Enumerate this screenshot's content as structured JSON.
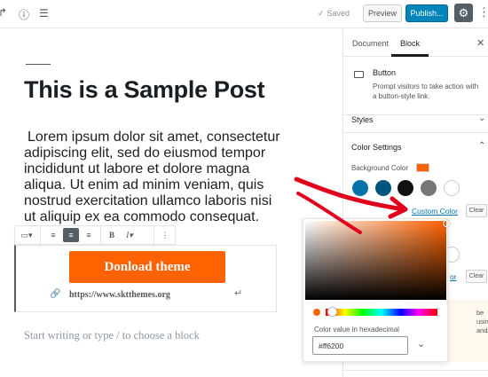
{
  "topbar": {
    "redo_icon": "redo-icon",
    "info_icon": "info-icon",
    "outline_icon": "list-icon",
    "saved_label": "Saved",
    "preview_label": "Preview",
    "publish_label": "Publish...",
    "gear_icon": "gear-icon",
    "more_icon": "more-vertical-icon"
  },
  "editor": {
    "title": "This is a Sample Post",
    "paragraph": "Lorem ipsum dolor sit amet, consectetur adipiscing elit, sed do eiusmod tempor incididunt ut labore et dolore magna aliqua. Ut enim ad minim veniam, quis nostrud exercitation ullamco laboris nisi ut aliquip ex ea commodo consequat.",
    "button_text": "Donload theme",
    "button_url": "https://www.sktthemes.org",
    "placeholder": "Start writing or type / to choose a block",
    "toolbar": {
      "bold_label": "B",
      "italic_label": "I"
    }
  },
  "sidebar": {
    "tabs": [
      {
        "label": "Document",
        "active": false
      },
      {
        "label": "Block",
        "active": true
      }
    ],
    "block": {
      "name": "Button",
      "description": "Prompt visitors to take action with a button-style link."
    },
    "styles_label": "Styles",
    "color_settings_label": "Color Settings",
    "background_color_label": "Background Color",
    "background_color": "#ff6200",
    "swatches": [
      "#0073aa",
      "#00567a",
      "#111111",
      "#777777",
      "#ffffff"
    ],
    "custom_color_label": "Custom Color",
    "clear_label": "Clear",
    "note_text": "be using and/or"
  },
  "picker": {
    "hex_label": "Color value in hexadecimal",
    "hex_value": "#ff6200",
    "current_color": "#ff6200"
  },
  "colors": {
    "accent": "#ff6200",
    "publish": "#0085ba",
    "annotation": "#e0001b"
  }
}
